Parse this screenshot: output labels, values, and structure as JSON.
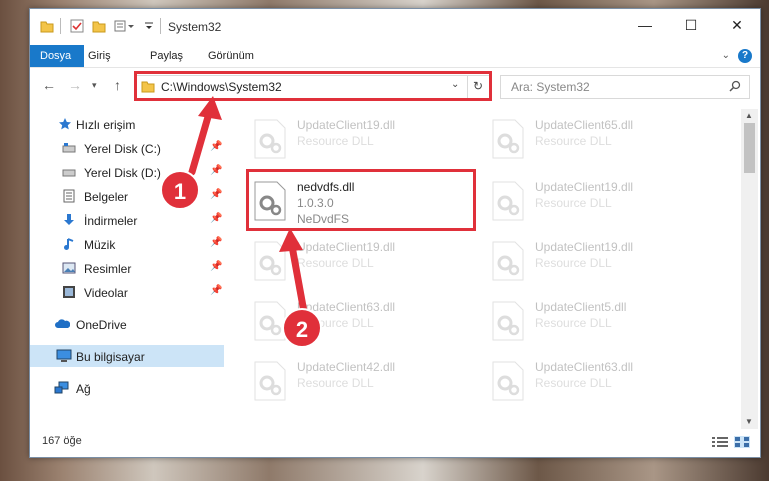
{
  "window": {
    "title": "System32",
    "controls": {
      "minimize": "—",
      "maximize": "☐",
      "close": "✕"
    }
  },
  "ribbon": {
    "tabs": [
      {
        "label": "Dosya",
        "active": true
      },
      {
        "label": "Giriş"
      },
      {
        "label": "Paylaş"
      },
      {
        "label": "Görünüm"
      }
    ],
    "help": "?"
  },
  "nav": {
    "address": "C:\\Windows\\System32",
    "search_placeholder": "Ara: System32"
  },
  "sidebar": {
    "items": [
      {
        "label": "Hızlı erişim",
        "icon": "star-icon"
      },
      {
        "label": "Yerel Disk (C:)",
        "icon": "drive-icon",
        "pinned": true
      },
      {
        "label": "Yerel Disk (D:)",
        "icon": "drive-icon",
        "pinned": true
      },
      {
        "label": "Belgeler",
        "icon": "documents-icon",
        "pinned": true
      },
      {
        "label": "İndirmeler",
        "icon": "downloads-icon",
        "pinned": true
      },
      {
        "label": "Müzik",
        "icon": "music-icon",
        "pinned": true
      },
      {
        "label": "Resimler",
        "icon": "pictures-icon",
        "pinned": true
      },
      {
        "label": "Videolar",
        "icon": "videos-icon",
        "pinned": true
      },
      {
        "label": "OneDrive",
        "icon": "cloud-icon"
      },
      {
        "label": "Bu bilgisayar",
        "icon": "computer-icon",
        "selected": true
      },
      {
        "label": "Ağ",
        "icon": "network-icon"
      }
    ]
  },
  "files": [
    {
      "name": "UpdateClient19.dll",
      "line2": "Resource DLL",
      "faded": true
    },
    {
      "name": "UpdateClient65.dll",
      "line2": "Resource DLL",
      "faded": true
    },
    {
      "name": "nedvdfs.dll",
      "line2": "1.0.3.0",
      "line3": "NeDvdFS",
      "faded": false,
      "highlighted": true
    },
    {
      "name": "UpdateClient19.dll",
      "line2": "Resource DLL",
      "faded": true
    },
    {
      "name": "UpdateClient19.dll",
      "line2": "Resource DLL",
      "faded": true
    },
    {
      "name": "UpdateClient19.dll",
      "line2": "Resource DLL",
      "faded": true
    },
    {
      "name": "UpdateClient63.dll",
      "line2": "Resource DLL",
      "faded": true
    },
    {
      "name": "UpdateClient5.dll",
      "line2": "Resource DLL",
      "faded": true
    },
    {
      "name": "UpdateClient42.dll",
      "line2": "Resource DLL",
      "faded": true
    },
    {
      "name": "UpdateClient63.dll",
      "line2": "Resource DLL",
      "faded": true
    }
  ],
  "status": {
    "count": "167 öğe"
  },
  "annotations": {
    "step1": "1",
    "step2": "2",
    "color": "#e0303a"
  }
}
